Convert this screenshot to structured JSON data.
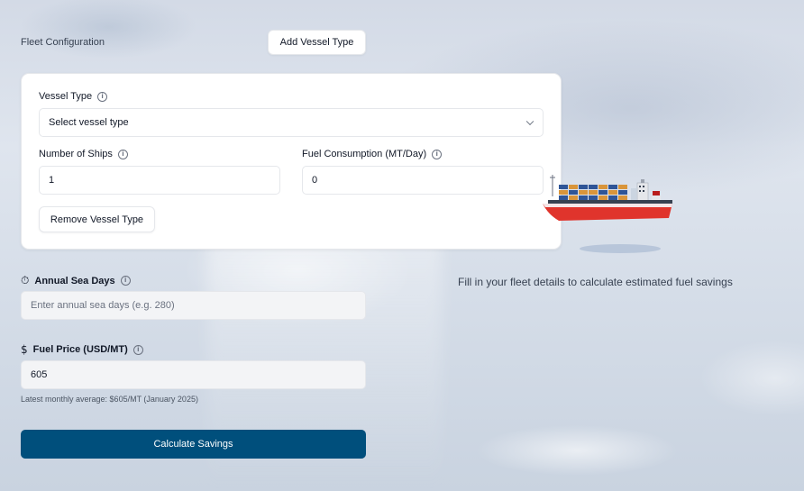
{
  "fleet": {
    "section_label": "Fleet Configuration",
    "add_button": "Add Vessel Type"
  },
  "vessel_card": {
    "vessel_type": {
      "label": "Vessel Type",
      "value": "Select vessel type"
    },
    "num_ships": {
      "label": "Number of Ships",
      "value": "1"
    },
    "fuel_consumption": {
      "label": "Fuel Consumption (MT/Day)",
      "value": "0"
    },
    "remove_button": "Remove Vessel Type"
  },
  "sea_days": {
    "label": "Annual Sea Days",
    "placeholder": "Enter annual sea days (e.g. 280)",
    "icon": "stopwatch-icon"
  },
  "fuel_price": {
    "label": "Fuel Price (USD/MT)",
    "value": "605",
    "hint": "Latest monthly average: $605/MT (January 2025)",
    "icon": "dollar-icon"
  },
  "calculate_button": "Calculate Savings",
  "results": {
    "empty_message": "Fill in your fleet details to calculate estimated fuel savings"
  },
  "colors": {
    "primary": "#004f7c",
    "ship_hull": "#e0342c"
  }
}
